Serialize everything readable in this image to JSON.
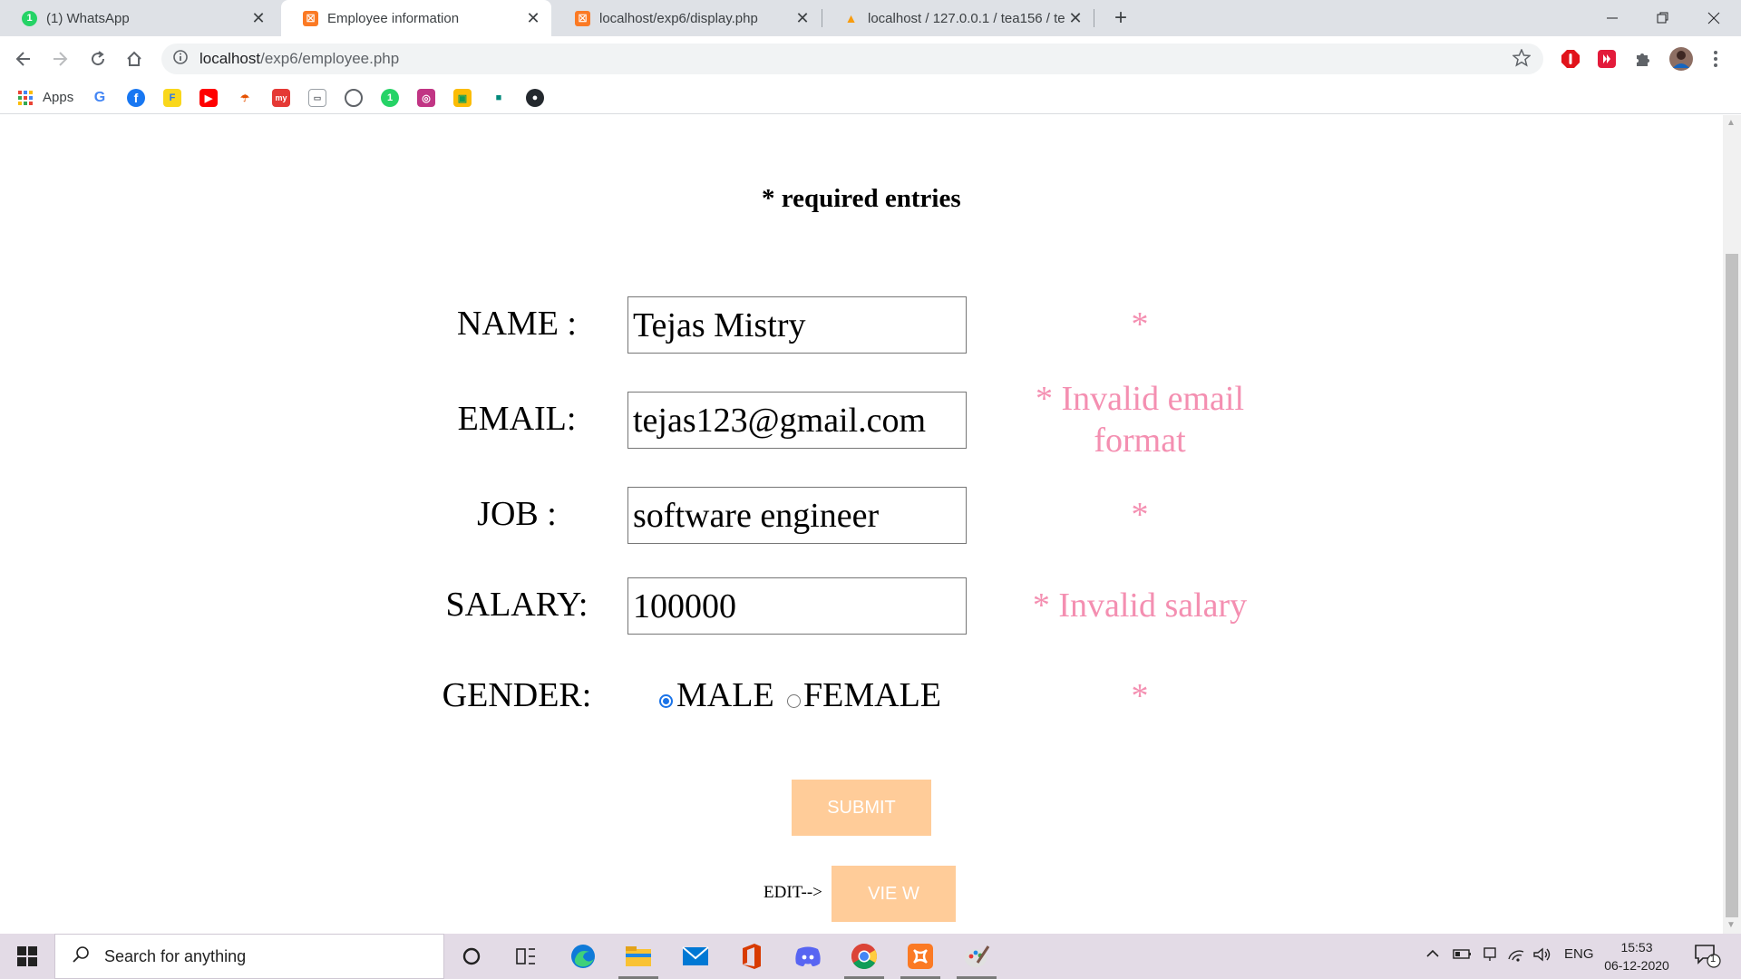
{
  "browser": {
    "tabs": [
      {
        "title": "(1) WhatsApp",
        "icon": "whatsapp-icon",
        "color": "#25d366",
        "active": false
      },
      {
        "title": "Employee information",
        "icon": "xampp-icon",
        "color": "#fb7a24",
        "active": true
      },
      {
        "title": "localhost/exp6/display.php",
        "icon": "xampp-icon",
        "color": "#fb7a24",
        "active": false
      },
      {
        "title": "localhost / 127.0.0.1 / tea156 / te",
        "icon": "phpmyadmin-icon",
        "color": "#f89c0e",
        "active": false
      }
    ],
    "url_host": "localhost",
    "url_path": "/exp6/employee.php",
    "bookmarks_apps_label": "Apps"
  },
  "form": {
    "required_note": "* required entries",
    "fields": [
      {
        "label": "NAME :",
        "value": "Tejas Mistry",
        "error": "*"
      },
      {
        "label": "EMAIL:",
        "value": "tejas123@gmail.com",
        "error": "* Invalid email format"
      },
      {
        "label": "JOB :",
        "value": "software engineer",
        "error": "*"
      },
      {
        "label": "SALARY:",
        "value": "100000",
        "error": "* Invalid salary"
      }
    ],
    "gender": {
      "label": "GENDER:",
      "options": [
        "MALE",
        "FEMALE"
      ],
      "selected": "MALE",
      "error": "*"
    },
    "submit_label": "SUBMIT",
    "edit_label": "EDIT-->",
    "view_label": "VIE W",
    "error_color": "#f48fb1",
    "button_color": "#ffcc99"
  },
  "taskbar": {
    "search_placeholder": "Search for anything",
    "language": "ENG",
    "time": "15:53",
    "date": "06-12-2020",
    "notification_count": "1"
  }
}
